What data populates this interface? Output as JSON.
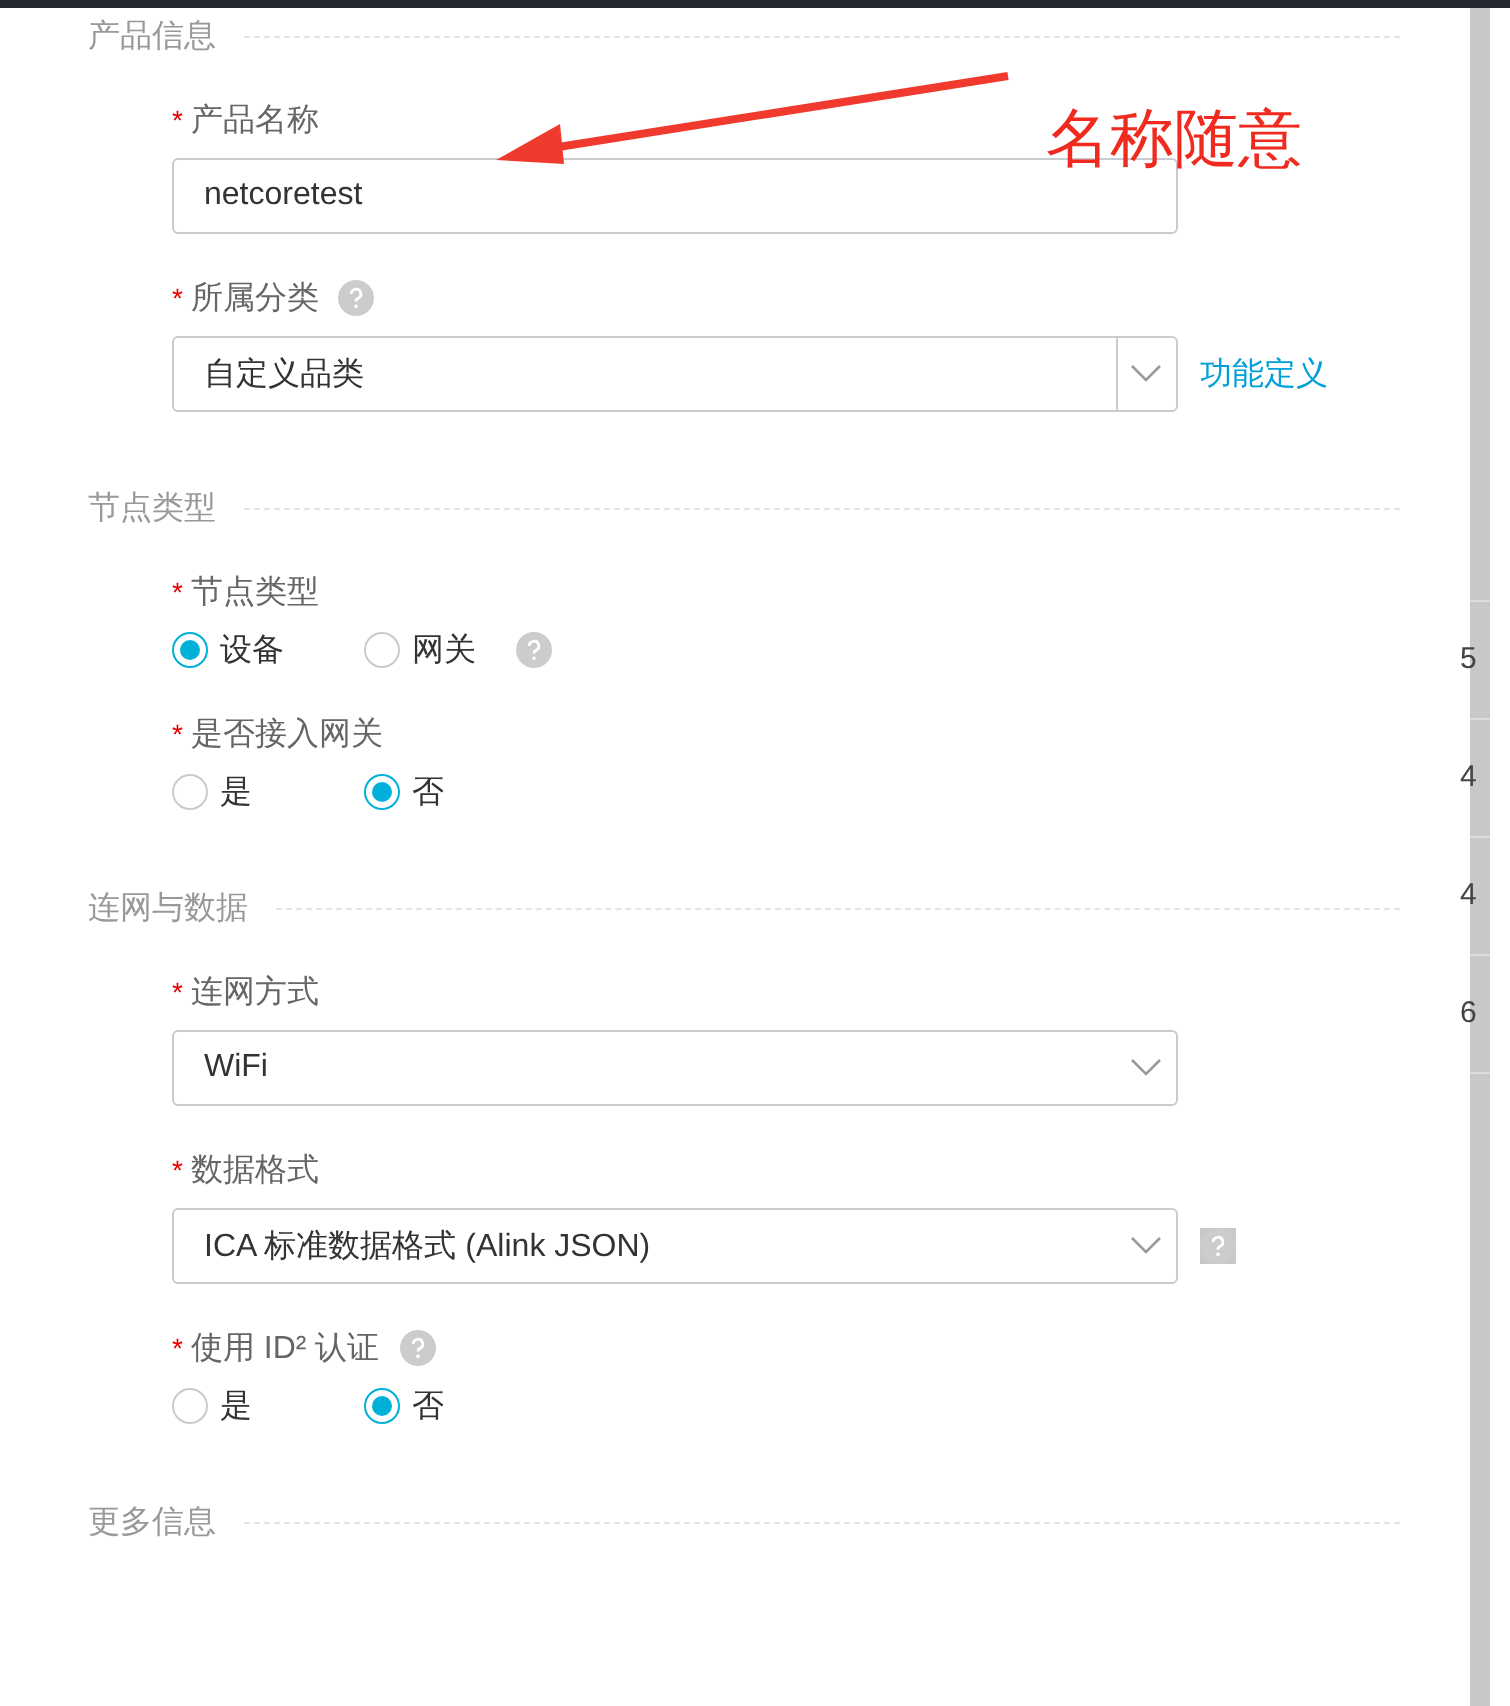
{
  "sections": [
    {
      "title": "产品信息",
      "fields": [
        {
          "kind": "text",
          "label": "产品名称",
          "required": "*",
          "help": false,
          "value": "netcoretest"
        },
        {
          "kind": "select",
          "label": "所属分类",
          "required": "*",
          "help": true,
          "value": "自定义品类",
          "divider": true,
          "link": "功能定义"
        }
      ]
    },
    {
      "title": "节点类型",
      "fields": [
        {
          "kind": "radio",
          "label": "节点类型",
          "required": "*",
          "help": false,
          "options": [
            {
              "label": "设备",
              "selected": true
            },
            {
              "label": "网关",
              "selected": false
            }
          ],
          "option_help": true
        },
        {
          "kind": "radio",
          "label": "是否接入网关",
          "required": "*",
          "help": false,
          "options": [
            {
              "label": "是",
              "selected": false
            },
            {
              "label": "否",
              "selected": true
            }
          ],
          "option_help": false
        }
      ]
    },
    {
      "title": "连网与数据",
      "fields": [
        {
          "kind": "select",
          "label": "连网方式",
          "required": "*",
          "help": false,
          "value": "WiFi",
          "divider": false
        },
        {
          "kind": "select",
          "label": "数据格式",
          "required": "*",
          "help": false,
          "value": "ICA 标准数据格式 (Alink JSON)",
          "divider": false,
          "side_help": true
        },
        {
          "kind": "radio",
          "label": "使用 ID² 认证",
          "required": "*",
          "help": true,
          "options": [
            {
              "label": "是",
              "selected": false
            },
            {
              "label": "否",
              "selected": true
            }
          ],
          "option_help": false
        }
      ]
    },
    {
      "title": "更多信息"
    }
  ],
  "annotation": {
    "text": "名称随意"
  },
  "side_cells": [
    "5",
    "4",
    "4",
    "6"
  ]
}
